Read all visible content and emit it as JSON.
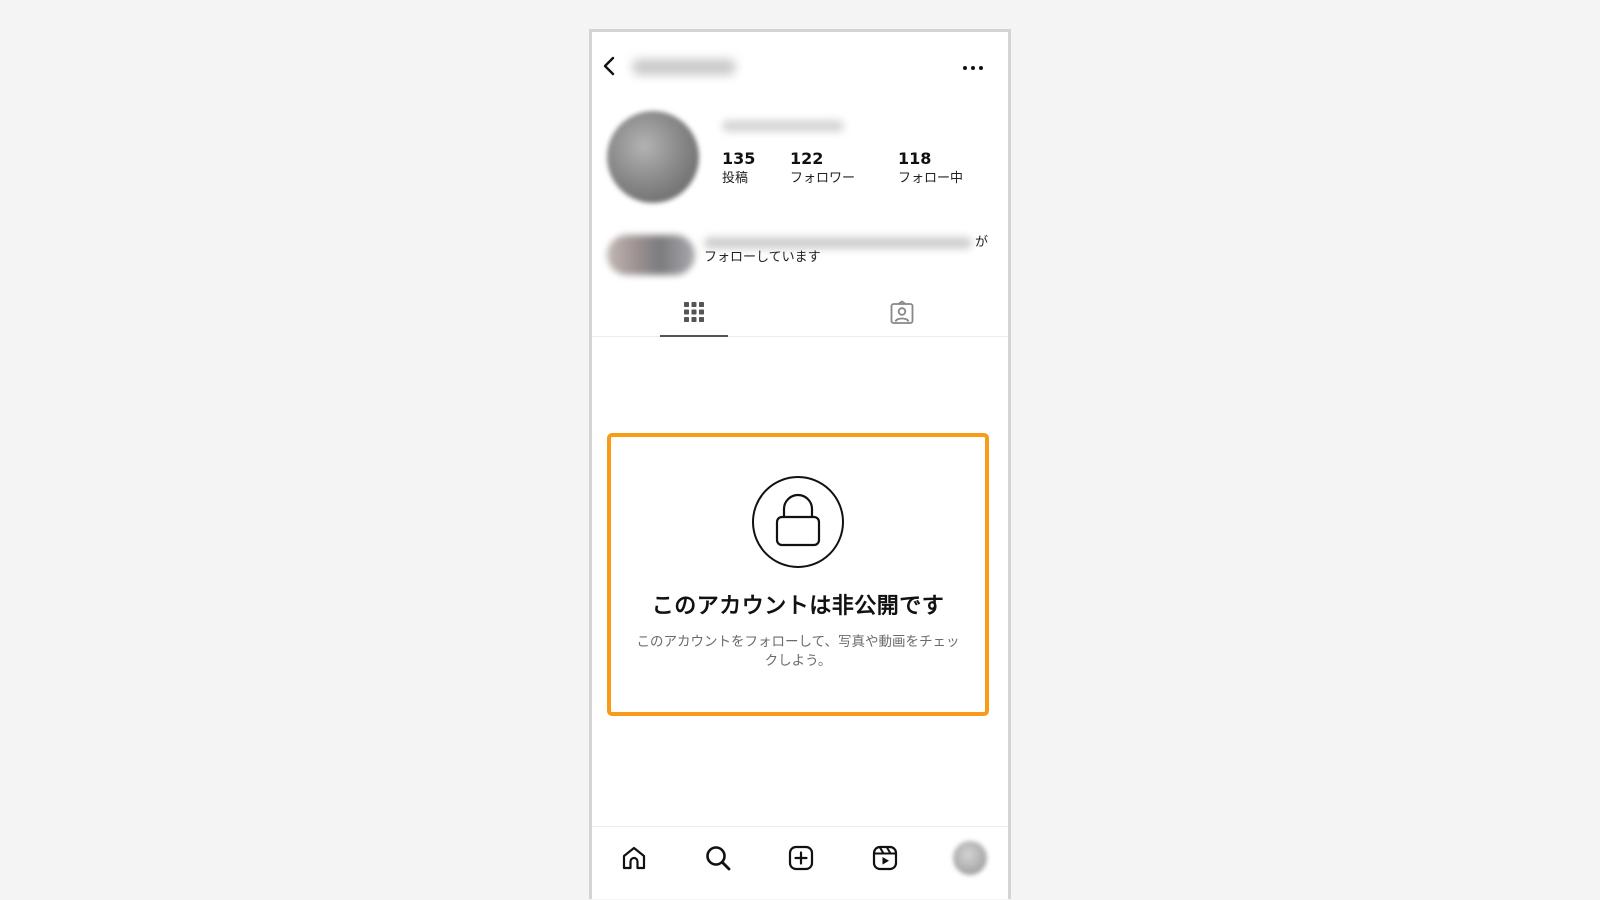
{
  "header": {
    "back_icon": "chevron-left-icon",
    "more_icon": "more-horizontal-icon"
  },
  "profile": {
    "stats": [
      {
        "value": "135",
        "label": "投稿"
      },
      {
        "value": "122",
        "label": "フォロワー"
      },
      {
        "value": "118",
        "label": "フォロー中"
      }
    ],
    "mutual_suffix": "が",
    "mutual_text": "フォローしています"
  },
  "tabs": [
    {
      "icon": "grid-icon",
      "active": true
    },
    {
      "icon": "tagged-person-icon",
      "active": false
    }
  ],
  "private_notice": {
    "icon": "lock-icon",
    "title": "このアカウントは非公開です",
    "subtitle": "このアカウントをフォローして、写真や動画をチェックしよう。",
    "highlight_color": "#f89b17"
  },
  "bottom_nav": [
    {
      "icon": "home-icon"
    },
    {
      "icon": "search-icon"
    },
    {
      "icon": "new-post-icon"
    },
    {
      "icon": "reels-icon"
    },
    {
      "icon": "profile-avatar"
    }
  ]
}
